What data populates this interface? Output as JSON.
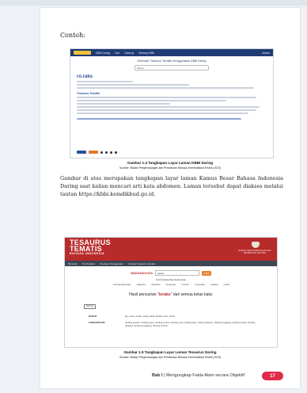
{
  "contoh": "Contoh:",
  "figure1": {
    "nav": [
      "KBBI Daring",
      "Cari",
      "Gabung",
      "Tentang KBBI",
      "Masuk"
    ],
    "info": "Informasi: Tesaurus Tematik menggunakan KBBI Daring",
    "search_value": "Raksa",
    "headword": "ro.raks",
    "subheading": "Tesaurus Tematis",
    "caption": "Gambar 1.4 Tangkapan Layar Laman KBBI Daring",
    "source": "Sumber: Badan Pengembangan dan Pembinaan Bahasa Kemendikbud Ristek (2023)"
  },
  "paragraph": "Gambar di atas merupakan tangkapan layar laman Kamus Besar Bahasa Indonesia Daring saat kalian mencari arti kata abdomen. Laman tersebut dapat diakses melalui tautan https://kbbi.kemdikbud.go.id.",
  "figure2": {
    "title_line1": "TESAURUS",
    "title_line2": "TEMATIS",
    "subtitle": "BAHASA INDONESIA",
    "org": "BADAN PENGEMBANGAN DAN PEMBINAAN BAHASA",
    "nav": [
      "Beranda",
      "Tim Redaksi",
      "Panduan Penggunaan",
      "Tentang Tesaurus Tematis"
    ],
    "search_label": "MASUKKAN KATA",
    "search_value": "toraks",
    "search_button": "CARI",
    "filter_label": "Cari berdasarkan kelas kata:",
    "filters": [
      "semua kelas kata",
      "adjektiva",
      "adverbia",
      "konjungsi",
      "nomina",
      "numeralia",
      "partikel",
      "verba"
    ],
    "result_prefix": "Hasil pencarian \"",
    "result_word": "toraks",
    "result_suffix": "\" dari semua kelas kata:",
    "tag": "Nomina",
    "row1_label": "BADAN",
    "row1_text": "iga, rusuk, toraks, tulang dada; badan, torso, tubuh",
    "row2_label": "SUBKATEGORI",
    "row2_text": "dinding sputum; dinding perut, dinding ventral, dinding usus, dinding bayi, dinding kelamin, dinding pinggang, dinding torakal, dinding panggul, dinding punggung, dinding lumbal",
    "caption": "Gambar 1.5 Tangkapan Layar Laman Tesaurus Daring",
    "source": "Sumber: Badan Pengembangan dan Pembinaan Bahasa Kemendikbud Ristek (2023)"
  },
  "footer": {
    "chapter": "Bab I",
    "title": "| Mengungkap Fakta Alam secara Objektif",
    "page": "17"
  }
}
